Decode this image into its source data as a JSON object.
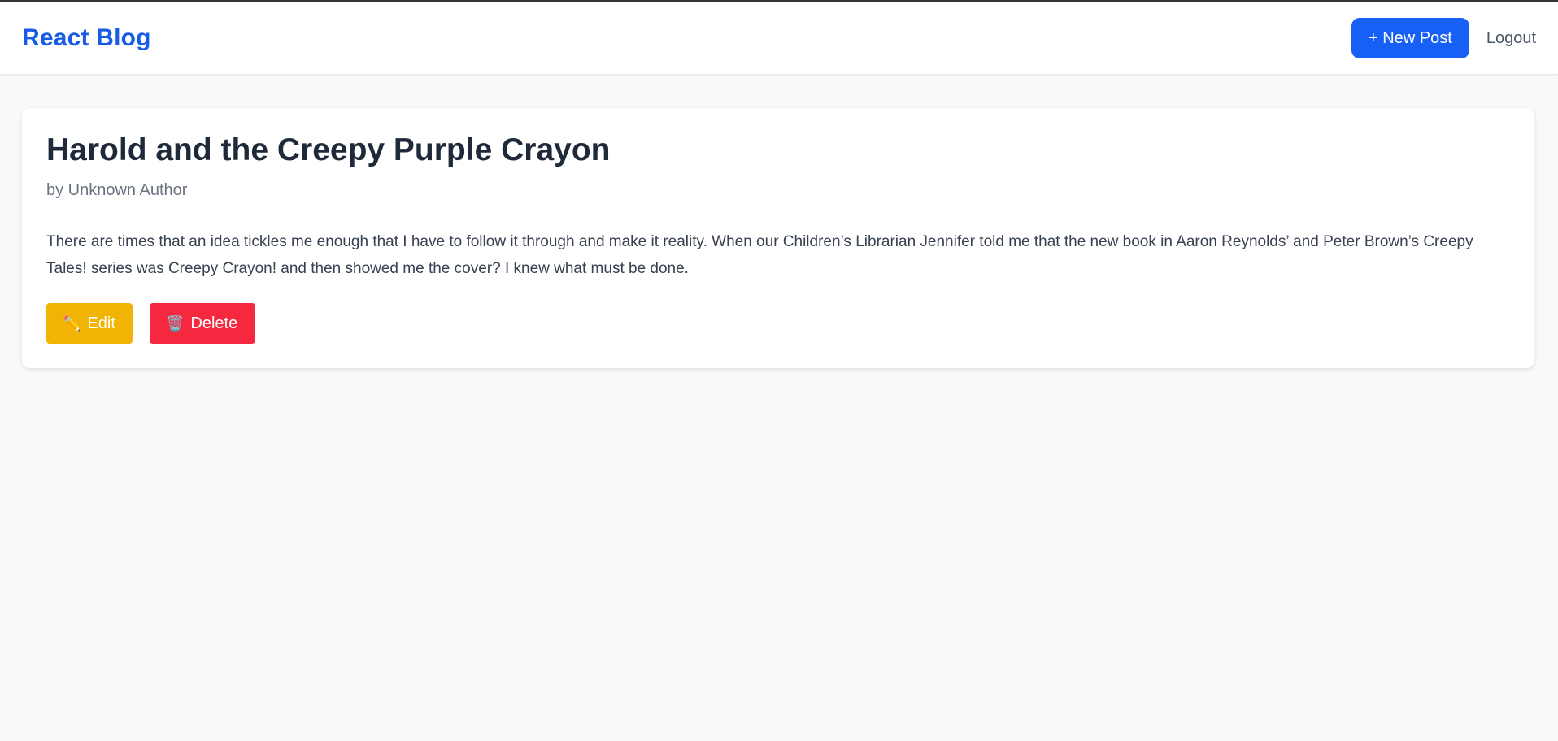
{
  "navbar": {
    "brand": "React Blog",
    "new_post_label": "+ New Post",
    "logout_label": "Logout"
  },
  "post": {
    "title": "Harold and the Creepy Purple Crayon",
    "author": "by Unknown Author",
    "body": "There are times that an idea tickles me enough that I have to follow it through and make it reality. When our Children’s Librarian Jennifer told me that the new book in Aaron Reynolds’ and Peter Brown’s Creepy Tales! series was Creepy Crayon! and then showed me the cover? I knew what must be done.",
    "edit_icon": "✏️",
    "edit_label": "Edit",
    "delete_icon": "🗑️",
    "delete_label": "Delete"
  },
  "colors": {
    "brand": "#1a5be6",
    "primary": "#1660f5",
    "edit": "#f2b404",
    "delete": "#f5283f",
    "background": "#f8f9fb"
  },
  "icons": {
    "edit": "pencil-icon",
    "delete": "trash-icon"
  }
}
